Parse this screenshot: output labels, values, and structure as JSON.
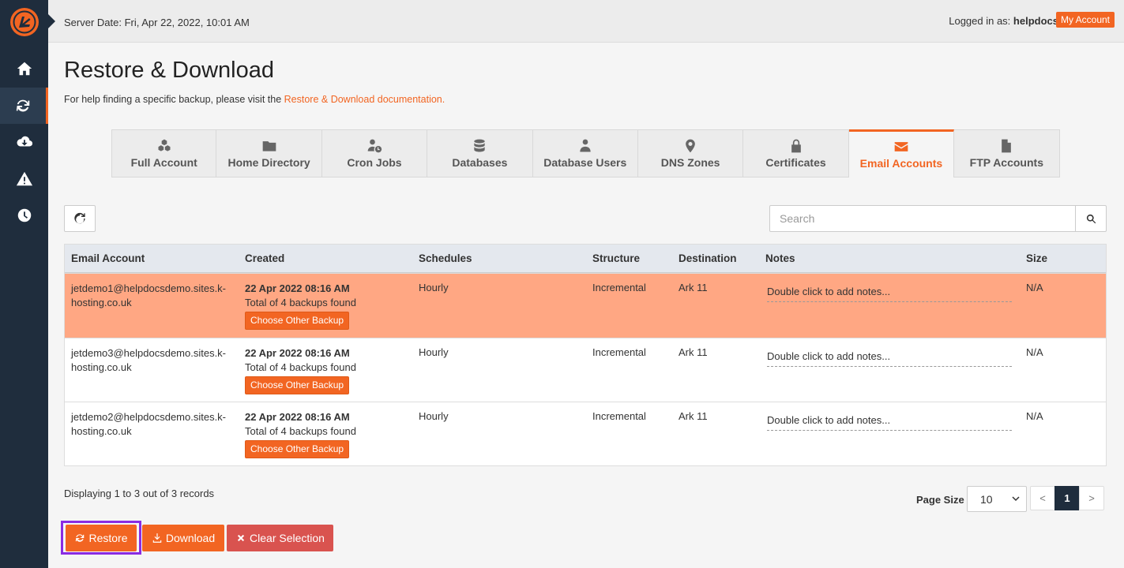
{
  "header": {
    "server_date": "Server Date: Fri, Apr 22, 2022, 10:01 AM",
    "logged_in_prefix": "Logged in as: ",
    "username": "helpdocs",
    "separator": " |",
    "my_account": "My Account"
  },
  "sidebar": {
    "items": [
      {
        "icon": "home-icon"
      },
      {
        "icon": "sync-icon",
        "active": true
      },
      {
        "icon": "cloud-download-icon"
      },
      {
        "icon": "warning-icon"
      },
      {
        "icon": "clock-icon"
      }
    ]
  },
  "page": {
    "title": "Restore & Download",
    "help_text": "For help finding a specific backup, please visit the ",
    "help_link": "Restore & Download documentation."
  },
  "tabs": [
    {
      "label": "Full Account",
      "icon": "cubes-icon"
    },
    {
      "label": "Home Directory",
      "icon": "folder-icon"
    },
    {
      "label": "Cron Jobs",
      "icon": "user-clock-icon"
    },
    {
      "label": "Databases",
      "icon": "database-icon"
    },
    {
      "label": "Database Users",
      "icon": "user-tie-icon"
    },
    {
      "label": "DNS Zones",
      "icon": "map-marker-icon"
    },
    {
      "label": "Certificates",
      "icon": "lock-icon"
    },
    {
      "label": "Email Accounts",
      "icon": "envelope-icon",
      "active": true
    },
    {
      "label": "FTP Accounts",
      "icon": "file-icon"
    }
  ],
  "search": {
    "placeholder": "Search"
  },
  "table": {
    "columns": [
      "Email Account",
      "Created",
      "Schedules",
      "Structure",
      "Destination",
      "Notes",
      "Size"
    ],
    "rows": [
      {
        "email_line1": "jetdemo1@helpdocsdemo.sites.k-",
        "email_line2": "hosting.co.uk",
        "created_date": "22 Apr 2022 08:16 AM",
        "created_total": "Total of 4 backups found",
        "choose_label": "Choose Other Backup",
        "schedule": "Hourly",
        "structure": "Incremental",
        "destination": "Ark 11",
        "notes": "Double click to add notes...",
        "size": "N/A",
        "selected": true
      },
      {
        "email_line1": "jetdemo3@helpdocsdemo.sites.k-",
        "email_line2": "hosting.co.uk",
        "created_date": "22 Apr 2022 08:16 AM",
        "created_total": "Total of 4 backups found",
        "choose_label": "Choose Other Backup",
        "schedule": "Hourly",
        "structure": "Incremental",
        "destination": "Ark 11",
        "notes": "Double click to add notes...",
        "size": "N/A",
        "selected": false
      },
      {
        "email_line1": "jetdemo2@helpdocsdemo.sites.k-",
        "email_line2": "hosting.co.uk",
        "created_date": "22 Apr 2022 08:16 AM",
        "created_total": "Total of 4 backups found",
        "choose_label": "Choose Other Backup",
        "schedule": "Hourly",
        "structure": "Incremental",
        "destination": "Ark 11",
        "notes": "Double click to add notes...",
        "size": "N/A",
        "selected": false
      }
    ]
  },
  "footer": {
    "records": "Displaying 1 to 3 out of 3 records",
    "page_size_label": "Page Size",
    "page_size_value": "10",
    "pager_prev": "<",
    "pager_current": "1",
    "pager_next": ">"
  },
  "actions": {
    "restore": "Restore",
    "download": "Download",
    "clear": "Clear Selection"
  },
  "colors": {
    "accent": "#f26522",
    "sidebar": "#1f2d3d",
    "selected_row": "#ffa783",
    "danger": "#d9534f"
  }
}
